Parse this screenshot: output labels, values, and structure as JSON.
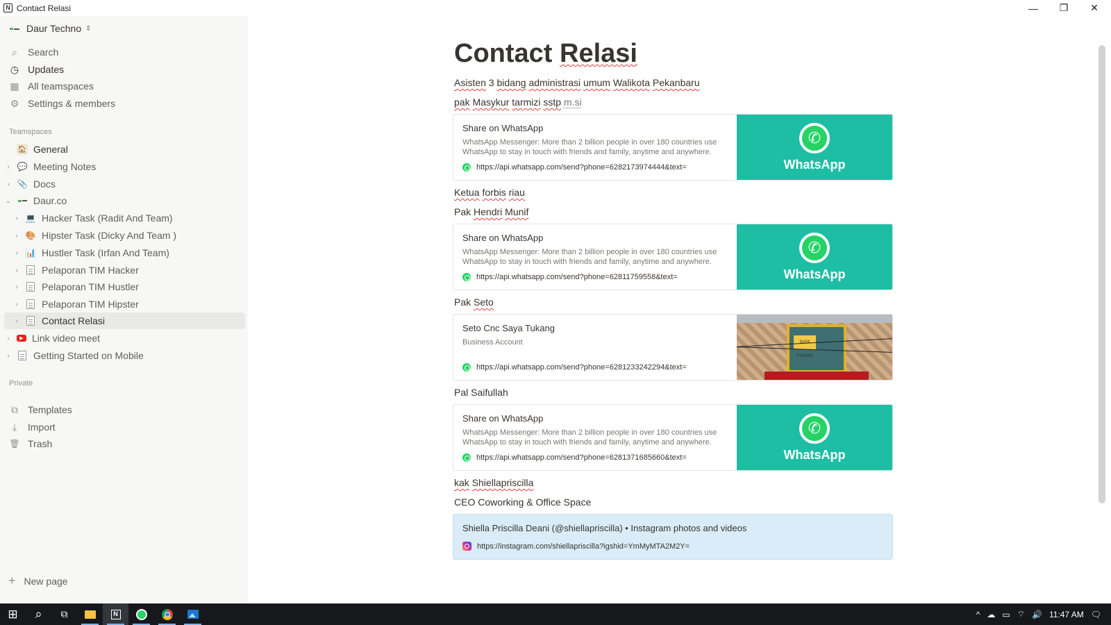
{
  "window": {
    "app_icon": "N",
    "title": "Contact Relasi",
    "controls": {
      "minimize": "—",
      "maximize": "❐",
      "close": "✕"
    }
  },
  "sidebar": {
    "workspace": {
      "name": "Daur Techno",
      "icon": "workspace-logo-icon",
      "switch_icon": "⇕"
    },
    "nav": [
      {
        "label": "Search",
        "icon": "search-icon",
        "glyph": "⌕"
      },
      {
        "label": "Updates",
        "icon": "clock-icon",
        "glyph": "◷"
      },
      {
        "label": "All teamspaces",
        "icon": "teamspaces-icon",
        "glyph": "▦"
      },
      {
        "label": "Settings & members",
        "icon": "gear-icon",
        "glyph": "⚙"
      }
    ],
    "teamspaces_label": "Teamspaces",
    "tree": [
      {
        "label": "General",
        "icon": "general-icon",
        "glyph": "🏠",
        "level": 0,
        "chevron": ""
      },
      {
        "label": "Meeting Notes",
        "icon": "speech-bubble-icon",
        "glyph": "💬",
        "level": 0,
        "chevron": "›"
      },
      {
        "label": "Docs",
        "icon": "paperclip-icon",
        "glyph": "📎",
        "level": 0,
        "chevron": "›"
      },
      {
        "label": "Daur.co",
        "icon": "workspace-logo-icon",
        "glyph": "▬",
        "level": 0,
        "chevron": "⌄"
      },
      {
        "label": "Hacker Task (Radit And Team)",
        "icon": "laptop-icon",
        "glyph": "💻",
        "level": 1,
        "chevron": "›"
      },
      {
        "label": "Hipster Task (Dicky And Team )",
        "icon": "palette-icon",
        "glyph": "🎨",
        "level": 1,
        "chevron": "›"
      },
      {
        "label": "Hustler Task (Irfan And Team)",
        "icon": "bar-chart-icon",
        "glyph": "📊",
        "level": 1,
        "chevron": "›"
      },
      {
        "label": "Pelaporan TIM Hacker",
        "icon": "page-icon",
        "glyph": "",
        "level": 1,
        "chevron": "›"
      },
      {
        "label": "Pelaporan TIM Hustler",
        "icon": "page-icon",
        "glyph": "",
        "level": 1,
        "chevron": "›"
      },
      {
        "label": "Pelaporan TIM Hipster",
        "icon": "page-icon",
        "glyph": "",
        "level": 1,
        "chevron": "›"
      },
      {
        "label": "Contact Relasi",
        "icon": "page-icon",
        "glyph": "",
        "level": 1,
        "chevron": "›",
        "active": true
      },
      {
        "label": "Link video meet",
        "icon": "youtube-icon",
        "glyph": "▶",
        "level": 0,
        "chevron": "›"
      },
      {
        "label": "Getting Started on Mobile",
        "icon": "page-icon",
        "glyph": "",
        "level": 0,
        "chevron": "›"
      }
    ],
    "private_label": "Private",
    "bottom_nav": [
      {
        "label": "Templates",
        "icon": "templates-icon",
        "glyph": "⧉"
      },
      {
        "label": "Import",
        "icon": "import-icon",
        "glyph": "⤓"
      },
      {
        "label": "Trash",
        "icon": "trash-icon",
        "glyph": "🗑"
      }
    ],
    "new_page_label": "New page",
    "new_page_glyph": "+"
  },
  "page": {
    "title_part1": "Contact ",
    "title_part2": "Relasi",
    "line1": [
      "Asisten",
      " 3 ",
      "bidang",
      " ",
      "administrasi",
      " ",
      "umum",
      " ",
      "Walikota",
      " ",
      "Pekanbaru"
    ],
    "line2": [
      "pak",
      " ",
      "Masykur",
      " ",
      "tarmizi",
      " ",
      "sstp",
      " ",
      "m.si"
    ],
    "bookmark1": {
      "title": "Share on WhatsApp",
      "desc": "WhatsApp Messenger: More than 2 billion people in over 180 countries use WhatsApp to stay in touch with friends and family, anytime and anywhere.",
      "url": "https://api.whatsapp.com/send?phone=6282173974444&text=",
      "image_text": "WhatsApp"
    },
    "line3": [
      "Ketua",
      " ",
      "forbis",
      " ",
      "riau"
    ],
    "line4": [
      "Pak ",
      "Hendri",
      " ",
      "Munif"
    ],
    "bookmark2": {
      "title": "Share on WhatsApp",
      "desc": "WhatsApp Messenger: More than 2 billion people in over 180 countries use WhatsApp to stay in touch with friends and family, anytime and anywhere.",
      "url": "https://api.whatsapp.com/send?phone=62811759558&text=",
      "image_text": "WhatsApp"
    },
    "line5": [
      "Pak ",
      "Seto"
    ],
    "bookmark3": {
      "title": "Seto Cnc Saya Tukang",
      "desc": "Business Account",
      "url": "https://api.whatsapp.com/send?phone=6281233242294&text=",
      "photo_sign": "SAYA TUKANG"
    },
    "line6": "Pal Saifullah",
    "bookmark4": {
      "title": "Share on WhatsApp",
      "desc": "WhatsApp Messenger: More than 2 billion people in over 180 countries use WhatsApp to stay in touch with friends and family, anytime and anywhere.",
      "url": "https://api.whatsapp.com/send?phone=6281371685660&text=",
      "image_text": "WhatsApp"
    },
    "line7": [
      "kak",
      " ",
      "Shiellapriscilla"
    ],
    "line8": "CEO Coworking & Office Space",
    "instagram": {
      "title": "Shiella Priscilla Deani (@shiellapriscilla) • Instagram photos and videos",
      "url": "https://instagram.com/shiellapriscilla?igshid=YmMyMTA2M2Y="
    }
  },
  "taskbar": {
    "start": "⊞",
    "search": "⌕",
    "taskview": "⧉",
    "apps": [
      {
        "name": "file-explorer-icon",
        "glyph": "📁"
      },
      {
        "name": "notion-icon",
        "glyph": "N"
      },
      {
        "name": "whatsapp-icon",
        "glyph": "✆"
      },
      {
        "name": "chrome-icon",
        "glyph": "◉"
      },
      {
        "name": "photos-icon",
        "glyph": "▣"
      }
    ],
    "tray": [
      "^",
      "☁",
      "▭",
      "⌔",
      "🔊"
    ],
    "clock": "11:47 AM",
    "notification": "🗨"
  },
  "colors": {
    "sidebar_bg": "#f7f7f5",
    "whatsapp_teal": "#1ebea5",
    "spell_underline": "#e03e3e",
    "instagram_card_bg": "#d9ecf7",
    "taskbar_bg": "#16181c"
  }
}
